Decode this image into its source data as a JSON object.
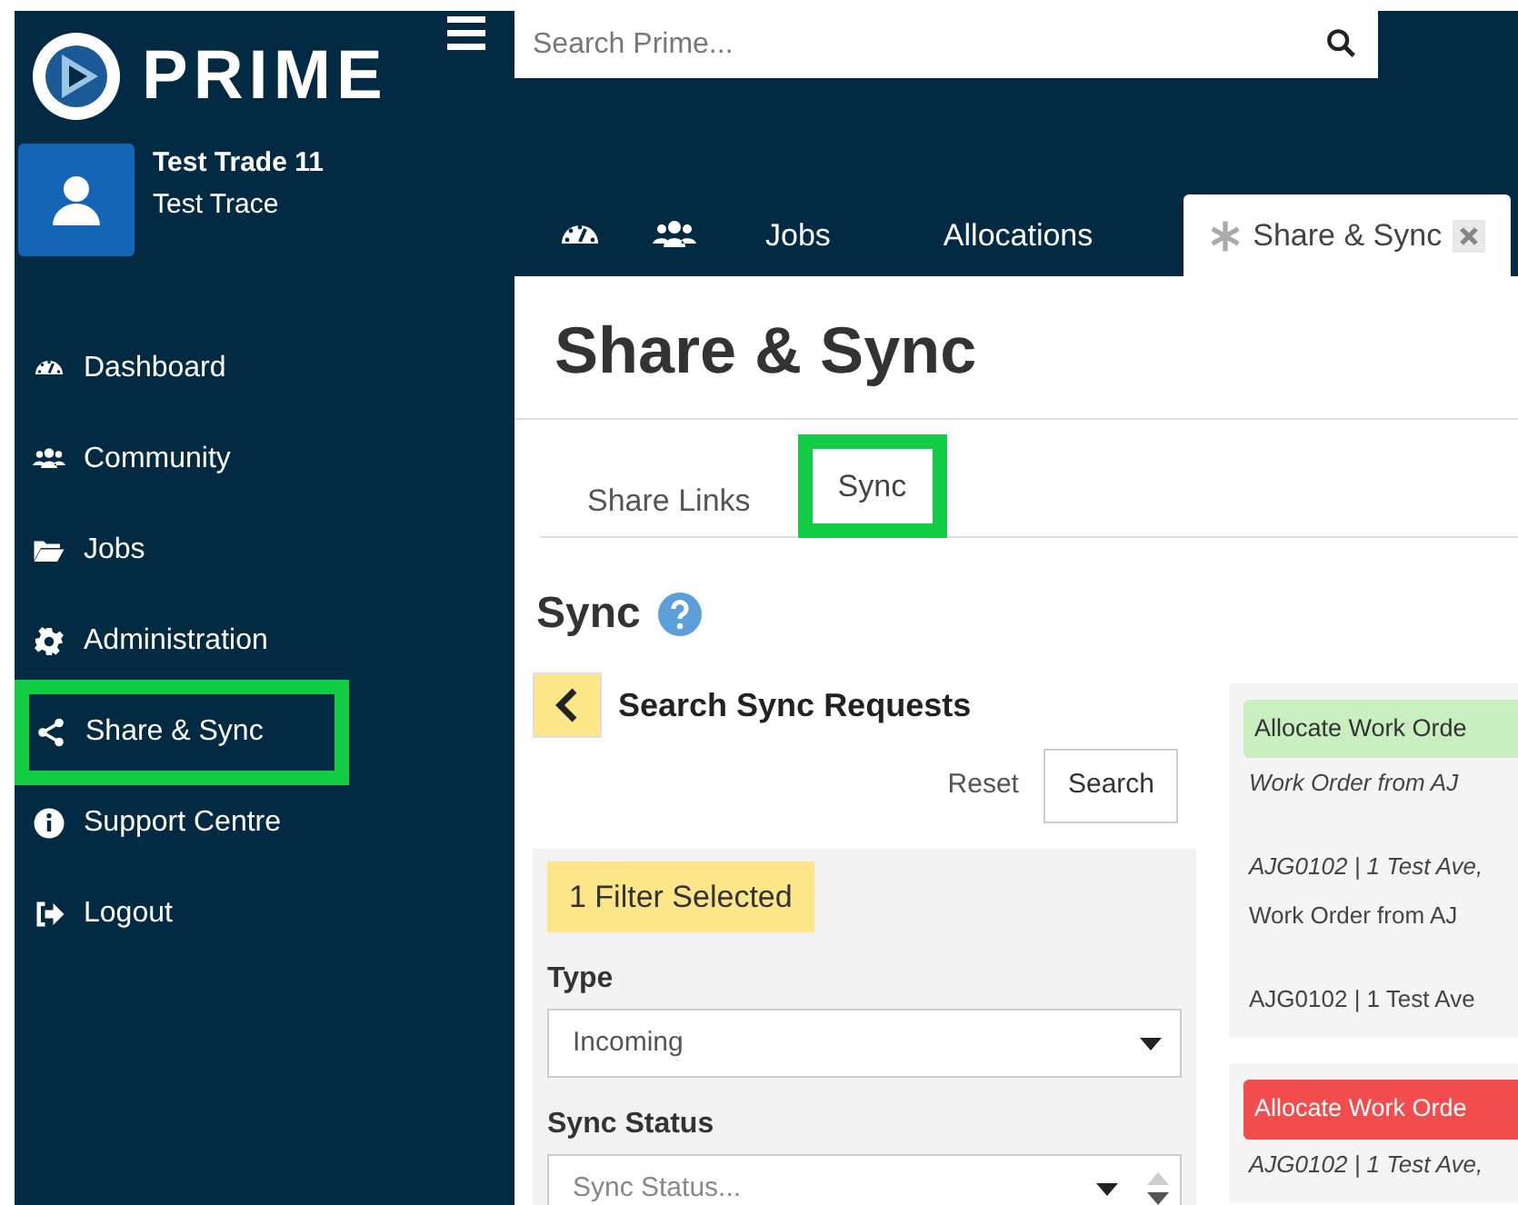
{
  "logo": {
    "text": "PRIME"
  },
  "search": {
    "placeholder": "Search Prime..."
  },
  "user": {
    "name": "Test Trade 11",
    "subtitle": "Test Trace"
  },
  "sidebar": {
    "items": [
      {
        "label": "Dashboard",
        "kind": "dashboard",
        "highlighted": false
      },
      {
        "label": "Community",
        "kind": "community",
        "highlighted": false
      },
      {
        "label": "Jobs",
        "kind": "folder",
        "highlighted": false
      },
      {
        "label": "Administration",
        "kind": "gear",
        "highlighted": false
      },
      {
        "label": "Share & Sync",
        "kind": "share",
        "highlighted": true
      },
      {
        "label": "Support Centre",
        "kind": "info",
        "highlighted": false
      },
      {
        "label": "Logout",
        "kind": "logout",
        "highlighted": false
      }
    ]
  },
  "tabs": [
    {
      "kind": "dashboard",
      "selected": false
    },
    {
      "kind": "community",
      "selected": false
    },
    {
      "kind": "text",
      "label": "Jobs",
      "selected": false
    },
    {
      "kind": "text",
      "label": "Allocations",
      "selected": false
    },
    {
      "kind": "closable",
      "label": "Share & Sync",
      "selected": true
    }
  ],
  "page_title": "Share & Sync",
  "subtabs": [
    {
      "label": "Share Links",
      "selected": false,
      "highlighted": false
    },
    {
      "label": "Sync",
      "selected": true,
      "highlighted": true
    }
  ],
  "section_title": "Sync",
  "search_panel": {
    "title": "Search Sync Requests",
    "reset": "Reset",
    "search": "Search",
    "filter_badge": "1 Filter Selected",
    "fields": [
      {
        "kind": "select",
        "label": "Type",
        "value": "Incoming"
      },
      {
        "kind": "spinner-select",
        "label": "Sync Status",
        "placeholder": "Sync Status..."
      }
    ]
  },
  "results": [
    {
      "kind": "success",
      "title": "Allocate Work Orde",
      "lines": [
        {
          "text": "Work Order from AJ",
          "italic": true
        },
        {
          "text": "AJG0102 | 1 Test Ave,",
          "italic": true,
          "gap": true
        },
        {
          "text": "Work Order from AJ",
          "italic": false
        },
        {
          "text": "AJG0102 | 1 Test Ave",
          "italic": false,
          "gap": true
        }
      ]
    },
    {
      "kind": "error",
      "title": "Allocate Work Orde",
      "lines": [
        {
          "text": "AJG0102 | 1 Test Ave,",
          "italic": true
        }
      ]
    }
  ]
}
